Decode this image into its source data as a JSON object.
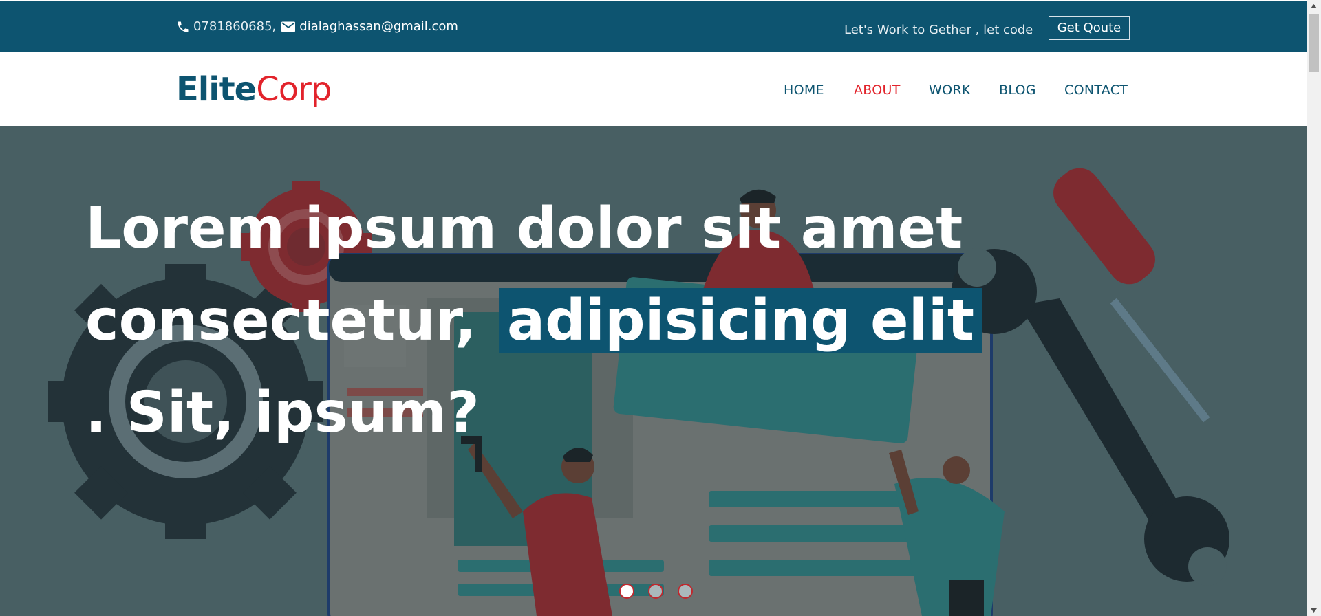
{
  "topbar": {
    "phone": "0781860685",
    "separator": ",",
    "email": "dialaghassan@gmail.com",
    "tagline": "Let's Work to Gether , let code",
    "quote_button": "Get Qoute",
    "icons": [
      "phone-icon",
      "envelope-icon"
    ]
  },
  "brand": {
    "part1": "Elite",
    "part2": "Corp"
  },
  "nav": {
    "items": [
      {
        "label": "HOME"
      },
      {
        "label": "ABOUT",
        "active": true
      },
      {
        "label": "WORK"
      },
      {
        "label": "BLOG"
      },
      {
        "label": "CONTACT"
      }
    ]
  },
  "hero": {
    "line1": "Lorem ipsum dolor sit amet",
    "line2_plain": "consectetur,",
    "line2_highlight": "adipisicing elit",
    "line3": ". Sit, ipsum?",
    "slides": {
      "count": 3,
      "active": 1
    }
  },
  "colors": {
    "brand_dark": "#0d5470",
    "brand_red": "#e2232b",
    "hero_overlay": "#485f63"
  }
}
